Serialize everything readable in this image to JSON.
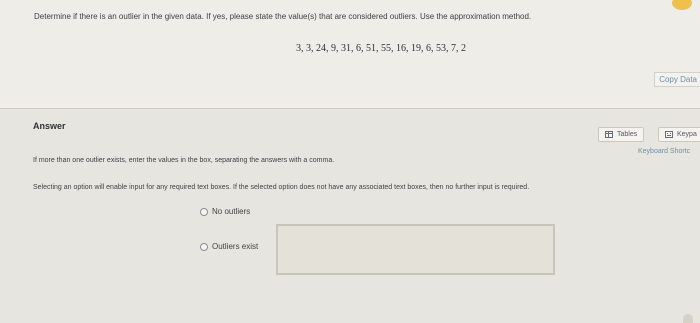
{
  "question": {
    "prompt": "Determine if there is an outlier in the given data. If yes, please state the value(s) that are considered outliers. Use the approximation method.",
    "data_values": "3, 3, 24, 9, 31, 6, 51, 55, 16, 19, 6, 53, 7, 2",
    "copy_data_label": "Copy Data"
  },
  "answer": {
    "label": "Answer",
    "tables_label": "Tables",
    "keypad_label": "Keypa",
    "keyboard_shortcuts_label": "Keyboard Shortc",
    "instruction_multiple": "If more than one outlier exists, enter the values in the box, separating the answers with a comma.",
    "instruction_options": "Selecting an option will enable input for any required text boxes. If the selected option does not have any associated text boxes, then no further input is required.",
    "options": [
      {
        "label": "No outliers"
      },
      {
        "label": "Outliers exist"
      }
    ],
    "outliers_input_value": ""
  }
}
